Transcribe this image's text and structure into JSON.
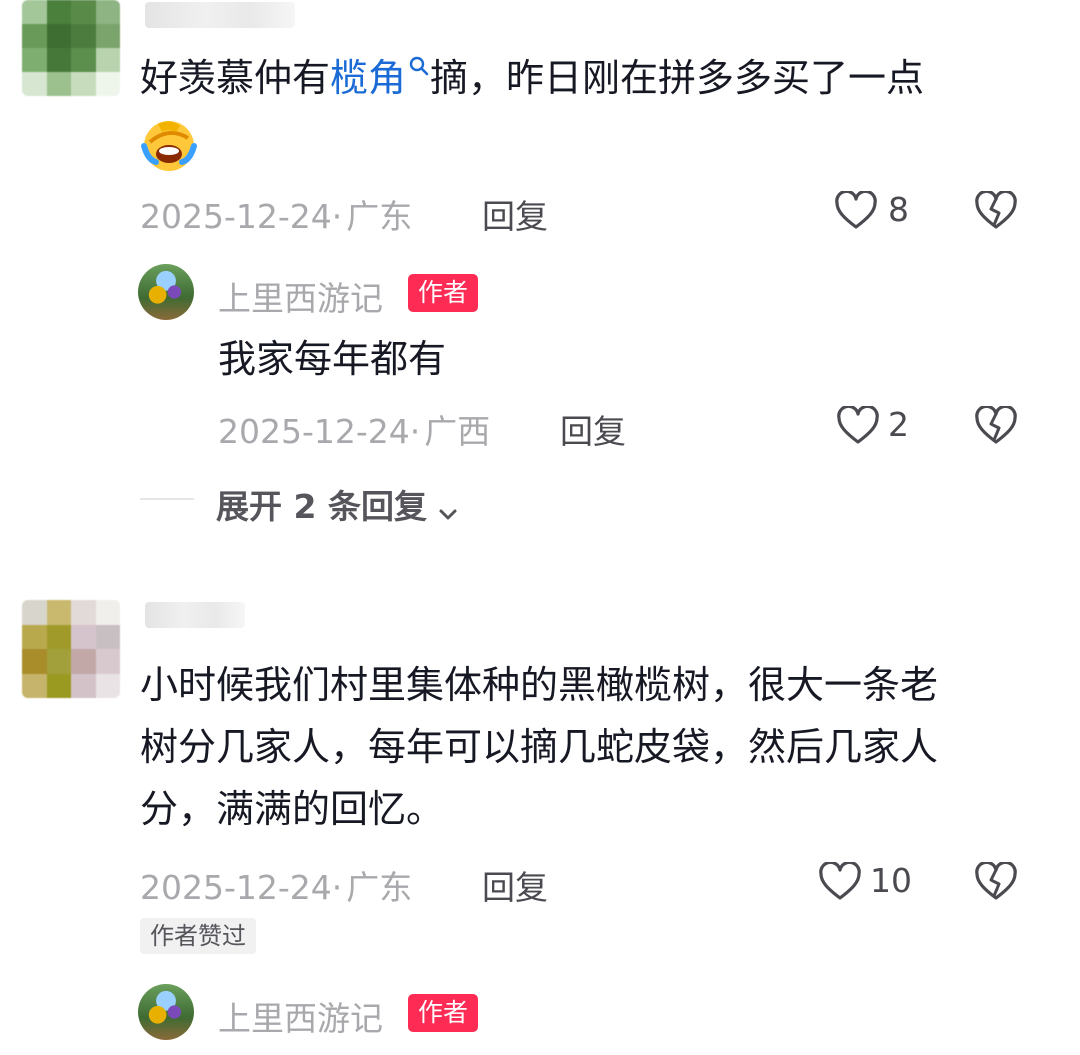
{
  "comments": [
    {
      "text_before": "好羡慕仲有",
      "keyword": "榄角",
      "text_after": "摘，昨日刚在拼多多买了一点",
      "emoji_icon": "laughing-crying-emoji-icon",
      "date": "2025-12-24",
      "separator": "·",
      "location": "广东",
      "reply_label": "回复",
      "likes": "8",
      "reply": {
        "author": "上里西游记",
        "badge": "作者",
        "text": "我家每年都有",
        "date": "2025-12-24",
        "separator": "·",
        "location": "广西",
        "reply_label": "回复",
        "likes": "2"
      },
      "expand_label": "展开 2 条回复"
    },
    {
      "lines": [
        "小时候我们村里集体种的黑橄榄树，很大一条老",
        "树分几家人，每年可以摘几蛇皮袋，然后几家人",
        "分，满满的回忆。"
      ],
      "date": "2025-12-24",
      "separator": "·",
      "location": "广东",
      "reply_label": "回复",
      "likes": "10",
      "author_liked": "作者赞过",
      "reply": {
        "author": "上里西游记",
        "badge": "作者"
      }
    }
  ],
  "colors": {
    "keyword": "#1b6bd6",
    "badge": "#fe2c55",
    "meta": "#a9a9ad"
  }
}
